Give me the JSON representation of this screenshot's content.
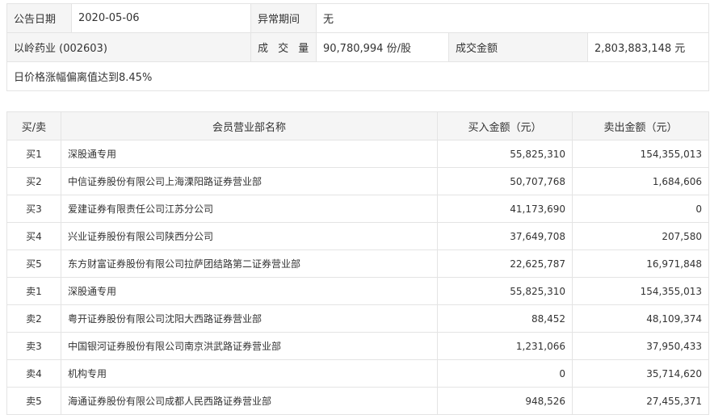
{
  "summary": {
    "date_label": "公告日期",
    "date_value": "2020-05-06",
    "period_label": "异常期间",
    "period_value": "无",
    "stock_name": "以岭药业 (002603)",
    "volume_label": "成 交 量",
    "volume_value": "90,780,994 份/股",
    "amount_label": "成交金额",
    "amount_value": "2,803,883,148 元",
    "reason": "日价格涨幅偏离值达到8.45%"
  },
  "detail": {
    "headers": [
      "买/卖",
      "会员营业部名称",
      "买入金额（元）",
      "卖出金额（元）"
    ],
    "rows": [
      {
        "side": "买1",
        "name": "深股通专用",
        "buy": "55,825,310",
        "sell": "154,355,013"
      },
      {
        "side": "买2",
        "name": "中信证券股份有限公司上海溧阳路证券营业部",
        "buy": "50,707,768",
        "sell": "1,684,606"
      },
      {
        "side": "买3",
        "name": "爱建证券有限责任公司江苏分公司",
        "buy": "41,173,690",
        "sell": "0"
      },
      {
        "side": "买4",
        "name": "兴业证券股份有限公司陕西分公司",
        "buy": "37,649,708",
        "sell": "207,580"
      },
      {
        "side": "买5",
        "name": "东方财富证券股份有限公司拉萨团结路第二证券营业部",
        "buy": "22,625,787",
        "sell": "16,971,848"
      },
      {
        "side": "卖1",
        "name": "深股通专用",
        "buy": "55,825,310",
        "sell": "154,355,013"
      },
      {
        "side": "卖2",
        "name": "粤开证券股份有限公司沈阳大西路证券营业部",
        "buy": "88,452",
        "sell": "48,109,374"
      },
      {
        "side": "卖3",
        "name": "中国银河证券股份有限公司南京洪武路证券营业部",
        "buy": "1,231,066",
        "sell": "37,950,433"
      },
      {
        "side": "卖4",
        "name": "机构专用",
        "buy": "0",
        "sell": "35,714,620"
      },
      {
        "side": "卖5",
        "name": "海通证券股份有限公司成都人民西路证券营业部",
        "buy": "948,526",
        "sell": "27,455,371"
      }
    ]
  }
}
